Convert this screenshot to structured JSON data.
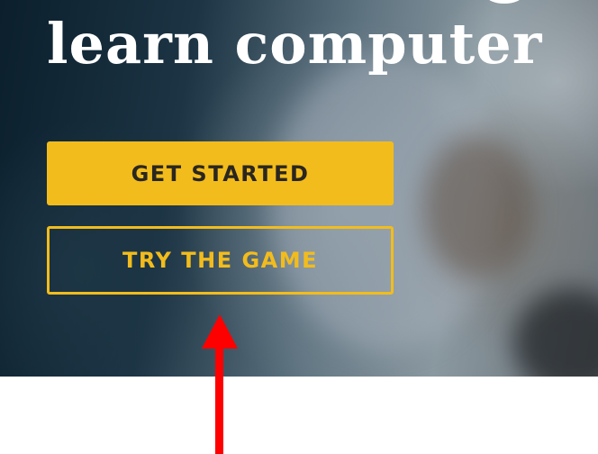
{
  "hero": {
    "title": "learn computer",
    "primary_button": "GET STARTED",
    "secondary_button": "TRY THE GAME"
  },
  "colors": {
    "accent": "#f2bc1c",
    "primary_button_text": "#2a2620",
    "annotation_arrow": "#ff0000"
  },
  "annotation": {
    "icon": "red-arrow-up-icon"
  }
}
